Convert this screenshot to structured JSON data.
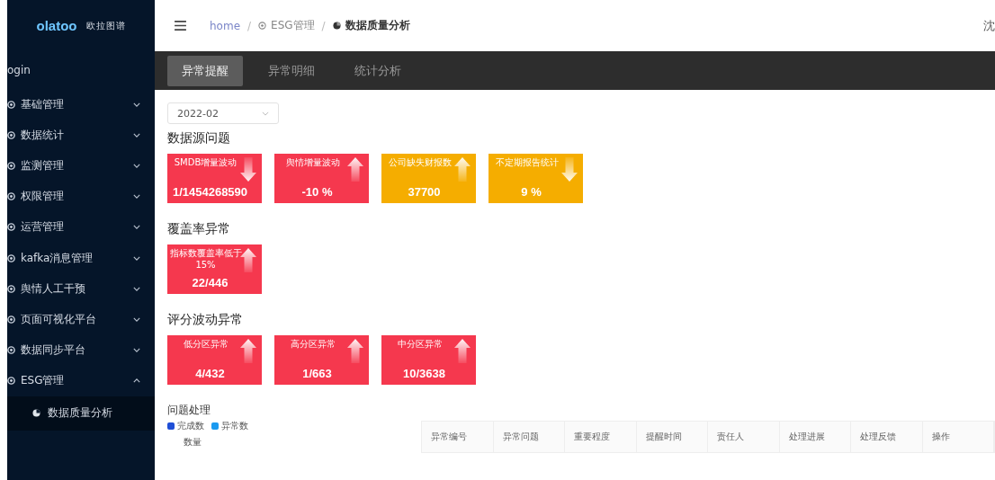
{
  "logo": {
    "brand": "olatoo",
    "name": "欧拉图谱"
  },
  "header": {
    "separator": "/",
    "breadcrumb": [
      {
        "label": "home",
        "kind": "link"
      },
      {
        "label": "ESG管理",
        "kind": "target"
      },
      {
        "label": "数据质量分析",
        "kind": "pie"
      }
    ],
    "user": "沈"
  },
  "sidebar": {
    "login": "ogin",
    "items": [
      {
        "label": "基础管理",
        "expanded": false
      },
      {
        "label": "数据统计",
        "expanded": false
      },
      {
        "label": "监测管理",
        "expanded": false
      },
      {
        "label": "权限管理",
        "expanded": false
      },
      {
        "label": "运营管理",
        "expanded": false
      },
      {
        "label": "kafka消息管理",
        "expanded": false
      },
      {
        "label": "舆情人工干预",
        "expanded": false
      },
      {
        "label": "页面可视化平台",
        "expanded": false
      },
      {
        "label": "数据同步平台",
        "expanded": false
      },
      {
        "label": "ESG管理",
        "expanded": true,
        "children": [
          {
            "label": "数据质量分析"
          }
        ]
      }
    ]
  },
  "tabs": [
    {
      "label": "异常提醒",
      "selected": true
    },
    {
      "label": "异常明细",
      "selected": false
    },
    {
      "label": "统计分析",
      "selected": false
    }
  ],
  "month_select": {
    "value": "2022-02"
  },
  "sections": [
    {
      "title": "数据源问题",
      "cards": [
        {
          "label": "SMDB增量波动",
          "value": "1/1454268590",
          "color": "#f5384e",
          "kind": "down"
        },
        {
          "label": "舆情增量波动",
          "value": "-10 %",
          "color": "#f5384e",
          "kind": "up"
        },
        {
          "label": "公司缺失财报数",
          "value": "37700",
          "color": "#f5ad00",
          "kind": "up"
        },
        {
          "label": "不定期报告统计",
          "value": "9 %",
          "color": "#f5ad00",
          "kind": "down"
        }
      ]
    },
    {
      "title": "覆盖率异常",
      "cards": [
        {
          "label": "指标数覆盖率低于15%",
          "value": "22/446",
          "color": "#f5384e",
          "kind": "up"
        }
      ]
    },
    {
      "title": "评分波动异常",
      "cards": [
        {
          "label": "低分区异常",
          "value": "4/432",
          "color": "#f5384e",
          "kind": "up"
        },
        {
          "label": "高分区异常",
          "value": "1/663",
          "color": "#f5384e",
          "kind": "up"
        },
        {
          "label": "中分区异常",
          "value": "10/3638",
          "color": "#f5384e",
          "kind": "up"
        }
      ]
    }
  ],
  "issues": {
    "title": "问题处理",
    "legend": [
      {
        "label": "完成数",
        "color": "#1f4fd6"
      },
      {
        "label": "异常数",
        "color": "#1a9af0"
      }
    ],
    "axis_label": "数量",
    "table": {
      "columns": [
        "异常编号",
        "异常问题",
        "重要程度",
        "提醒时间",
        "责任人",
        "处理进展",
        "处理反馈",
        "操作"
      ]
    }
  }
}
